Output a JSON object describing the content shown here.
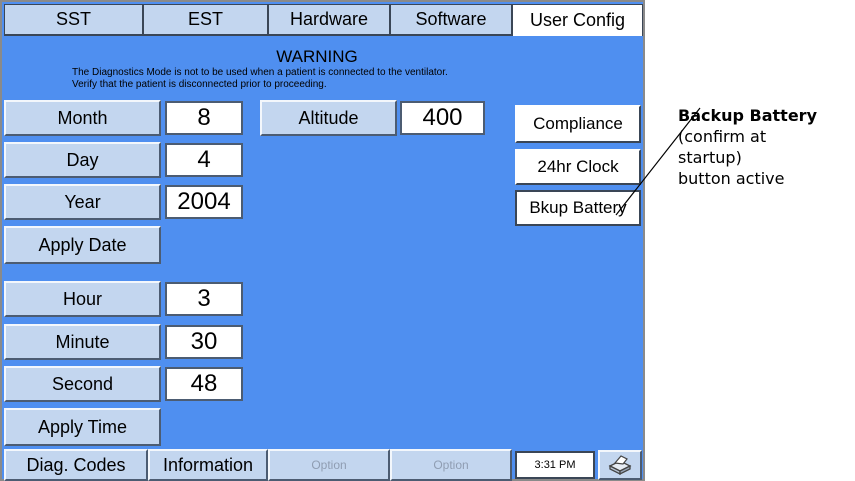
{
  "tabs": [
    {
      "label": "SST"
    },
    {
      "label": "EST"
    },
    {
      "label": "Hardware"
    },
    {
      "label": "Software"
    },
    {
      "label": "User Config"
    }
  ],
  "warning": {
    "title": "WARNING",
    "line1": "The Diagnostics Mode is not to be used when a patient is connected to the ventilator.",
    "line2": "Verify that the patient is disconnected prior to proceeding."
  },
  "date": {
    "month_label": "Month",
    "month_value": "8",
    "day_label": "Day",
    "day_value": "4",
    "year_label": "Year",
    "year_value": "2004",
    "apply_label": "Apply Date"
  },
  "altitude": {
    "label": "Altitude",
    "value": "400"
  },
  "time": {
    "hour_label": "Hour",
    "hour_value": "3",
    "minute_label": "Minute",
    "minute_value": "30",
    "second_label": "Second",
    "second_value": "48",
    "apply_label": "Apply Time"
  },
  "right_buttons": {
    "compliance": "Compliance",
    "clock24": "24hr Clock",
    "bkup_battery": "Bkup Battery"
  },
  "bottom": {
    "diag_codes": "Diag. Codes",
    "information": "Information",
    "option1": "Option",
    "option2": "Option",
    "clock": "3:31 PM",
    "printer_icon": "printer-icon"
  },
  "callout": {
    "title": "Backup Battery",
    "line1": "(confirm at",
    "line2": "startup)",
    "line3": "button active"
  },
  "colors": {
    "screen_bg": "#4f8ff0",
    "button_bg": "#c3d6ef",
    "field_bg": "#ffffff"
  }
}
